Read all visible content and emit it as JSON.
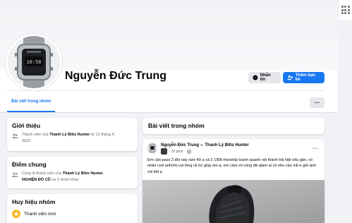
{
  "profile": {
    "name": "Nguyễn Đức Trung",
    "message_label": "Nhắn tin",
    "add_friend_label": "Thêm bạn bè",
    "more_label": "···"
  },
  "tabs": [
    {
      "label": "Bài viết trong nhóm",
      "active": true
    }
  ],
  "intro": {
    "title": "Giới thiệu",
    "member_prefix": "Thành viên của ",
    "group_name": "Thanh Lý Bitis Hunter",
    "member_suffix": " từ 12 tháng 4,",
    "member_year": "2023"
  },
  "common": {
    "title": "Điểm chung",
    "prefix": "Cùng là thành viên của ",
    "group_name": "Thanh Lý Bitis Hunter",
    "sep": ",",
    "group2": "NGHIỆN ĐỒ CŨ",
    "suffix": " và 3 nhóm khác"
  },
  "badges": {
    "title": "Huy hiệu nhóm",
    "item": "Thành viên mới"
  },
  "posts": {
    "title": "Bài viết trong nhóm",
    "post": {
      "author": "Nguyễn Đức Trung",
      "arrow": "▸",
      "group": "Thanh Lý Bitis Hunter",
      "time": "26 phút",
      "dot": "·",
      "text": "Em cần pass 2 đôi này size 40 ạ cả 2 150k freeship loanh quanh nội thành Hà Nội nếu gần, có nhận cod anh/chị vui lòng ck trc giúp em ạ, em cảm ơn mng đã qtam ai có nhu cầu inb e gửi ảnh chi tiết ạ",
      "more": "···"
    }
  },
  "colors": {
    "accent": "#1877f2",
    "background": "#f0f2f5",
    "secondary_text": "#65676b"
  },
  "icons": [
    "grid-menu-icon",
    "messenger-icon",
    "add-friend-icon",
    "group-icon",
    "badge-icon",
    "globe-icon"
  ]
}
